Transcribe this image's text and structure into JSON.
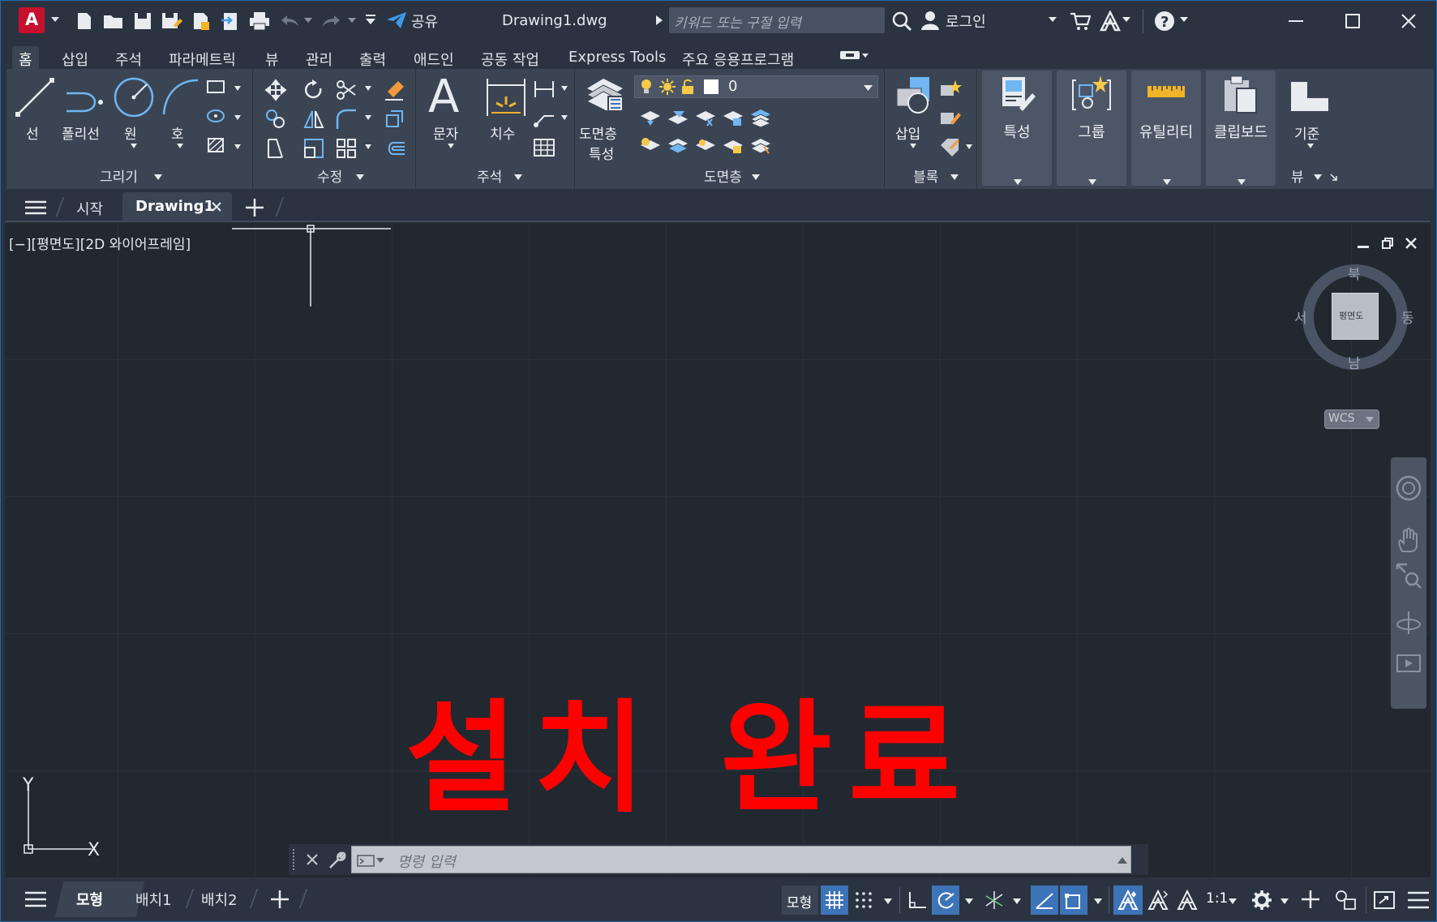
{
  "titlebar": {
    "app_logo": "A",
    "share_label": "공유",
    "document_title": "Drawing1.dwg",
    "search_placeholder": "키워드 또는 구절 입력",
    "login_label": "로그인"
  },
  "ribbon_tabs": [
    "홈",
    "삽입",
    "주석",
    "파라메트릭",
    "뷰",
    "관리",
    "출력",
    "애드인",
    "공동 작업",
    "Express Tools",
    "주요 응용프로그램"
  ],
  "ribbon": {
    "draw": {
      "label": "그리기",
      "line": "선",
      "polyline": "폴리선",
      "circle": "원",
      "arc": "호"
    },
    "modify": {
      "label": "수정"
    },
    "annotation": {
      "label": "주석",
      "text": "문자",
      "dimension": "치수"
    },
    "layers": {
      "label": "도면층",
      "properties_line1": "도면층",
      "properties_line2": "특성",
      "current_layer": "0"
    },
    "block": {
      "label": "블록",
      "insert": "삽입"
    },
    "properties": "특성",
    "groups": "그룹",
    "utilities": "유틸리티",
    "clipboard": "클립보드",
    "view": {
      "base": "기준",
      "label": "뷰"
    }
  },
  "file_tabs": {
    "start": "시작",
    "drawing": "Drawing1"
  },
  "viewport": {
    "label": "[−][평면도][2D 와이어프레임]",
    "overlay_text": "설치 완료",
    "viewcube": {
      "north": "북",
      "south": "남",
      "east": "동",
      "west": "서",
      "face": "평면도",
      "wcs": "WCS"
    },
    "ucs": {
      "x": "X",
      "y": "Y"
    }
  },
  "command_line": {
    "placeholder": "명령 입력"
  },
  "layout_tabs": {
    "model": "모형",
    "layout1": "배치1",
    "layout2": "배치2"
  },
  "status": {
    "model": "모형",
    "scale": "1:1"
  },
  "colors": {
    "accent": "#3d74b8",
    "logo": "#c8102e",
    "overlay": "#ff0000",
    "canvas": "#212830"
  }
}
